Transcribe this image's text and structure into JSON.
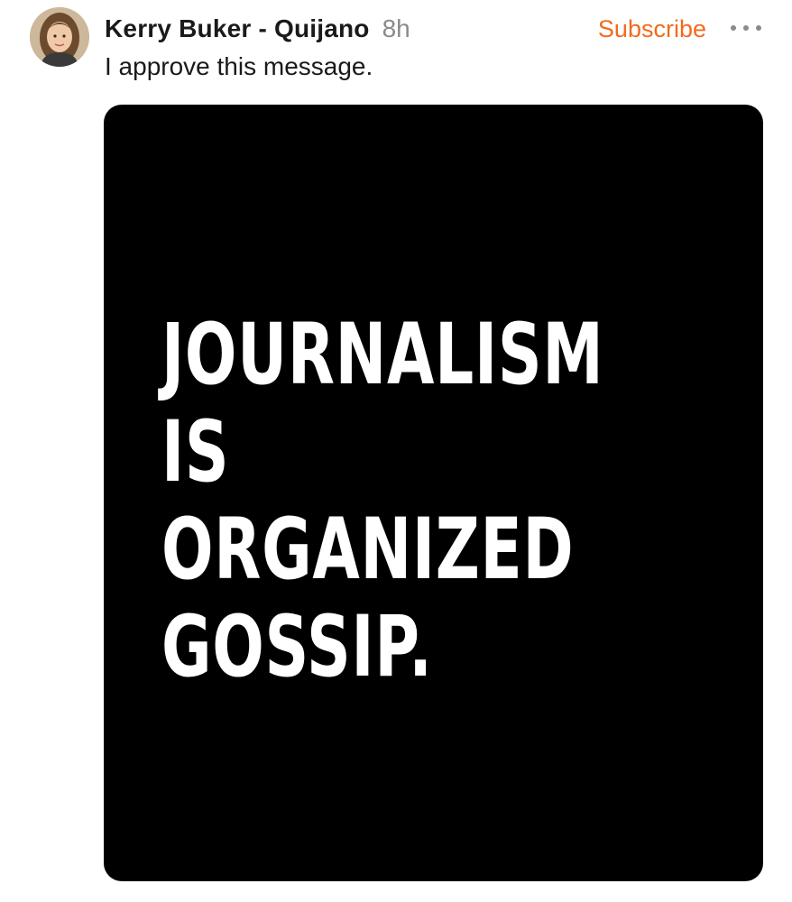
{
  "post": {
    "author": "Kerry Buker - Quijano",
    "time": "8h",
    "subscribe_label": "Subscribe",
    "text": "I approve this message.",
    "image_lines": [
      "JOURNALISM",
      "IS",
      "ORGANIZED",
      "GOSSIP."
    ]
  },
  "icons": {
    "avatar": "profile-photo",
    "more": "more-options-icon"
  },
  "colors": {
    "accent": "#f26b1d",
    "muted": "#8a8a8a",
    "text": "#1a1a1a",
    "image_bg": "#000000",
    "image_text": "#ffffff"
  }
}
